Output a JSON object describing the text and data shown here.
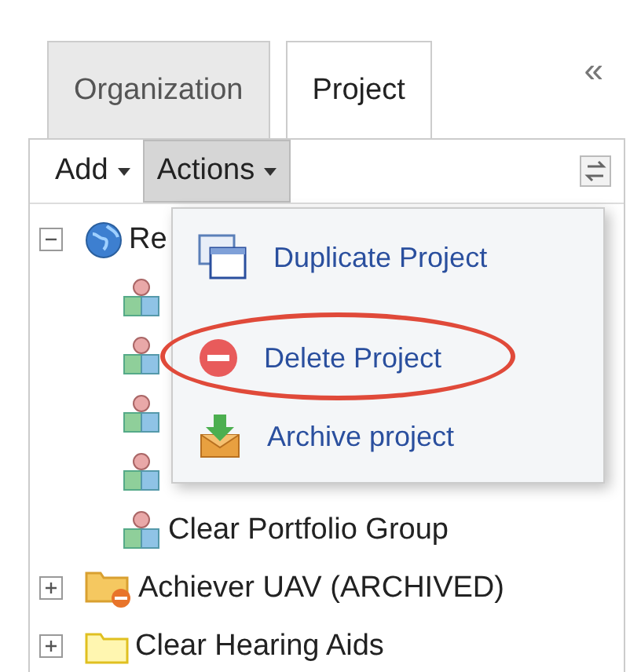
{
  "tabs": [
    {
      "label": "Organization",
      "selected": false
    },
    {
      "label": "Project",
      "selected": true
    }
  ],
  "collapse_button": {
    "label": "«"
  },
  "toolbar": {
    "buttons": [
      {
        "label": "Add",
        "pressed": false
      },
      {
        "label": "Actions",
        "pressed": true
      }
    ]
  },
  "tree": [
    {
      "kind": "globe",
      "label": "Re",
      "expanded": true,
      "children": [
        {
          "kind": "group"
        },
        {
          "kind": "group"
        },
        {
          "kind": "group"
        },
        {
          "kind": "group"
        },
        {
          "kind": "group",
          "label": "Clear Portfolio Group"
        }
      ]
    },
    {
      "kind": "archived-folder",
      "label": "Achiever UAV (ARCHIVED)",
      "expanded": false
    },
    {
      "kind": "folder",
      "label": "Clear Hearing Aids",
      "expanded": false
    }
  ],
  "actions_menu": [
    {
      "kind": "duplicate",
      "label": "Duplicate Project",
      "annotated": false
    },
    {
      "kind": "delete",
      "label": "Delete Project",
      "annotated": true
    },
    {
      "kind": "archive",
      "label": "Archive project",
      "annotated": false
    }
  ]
}
